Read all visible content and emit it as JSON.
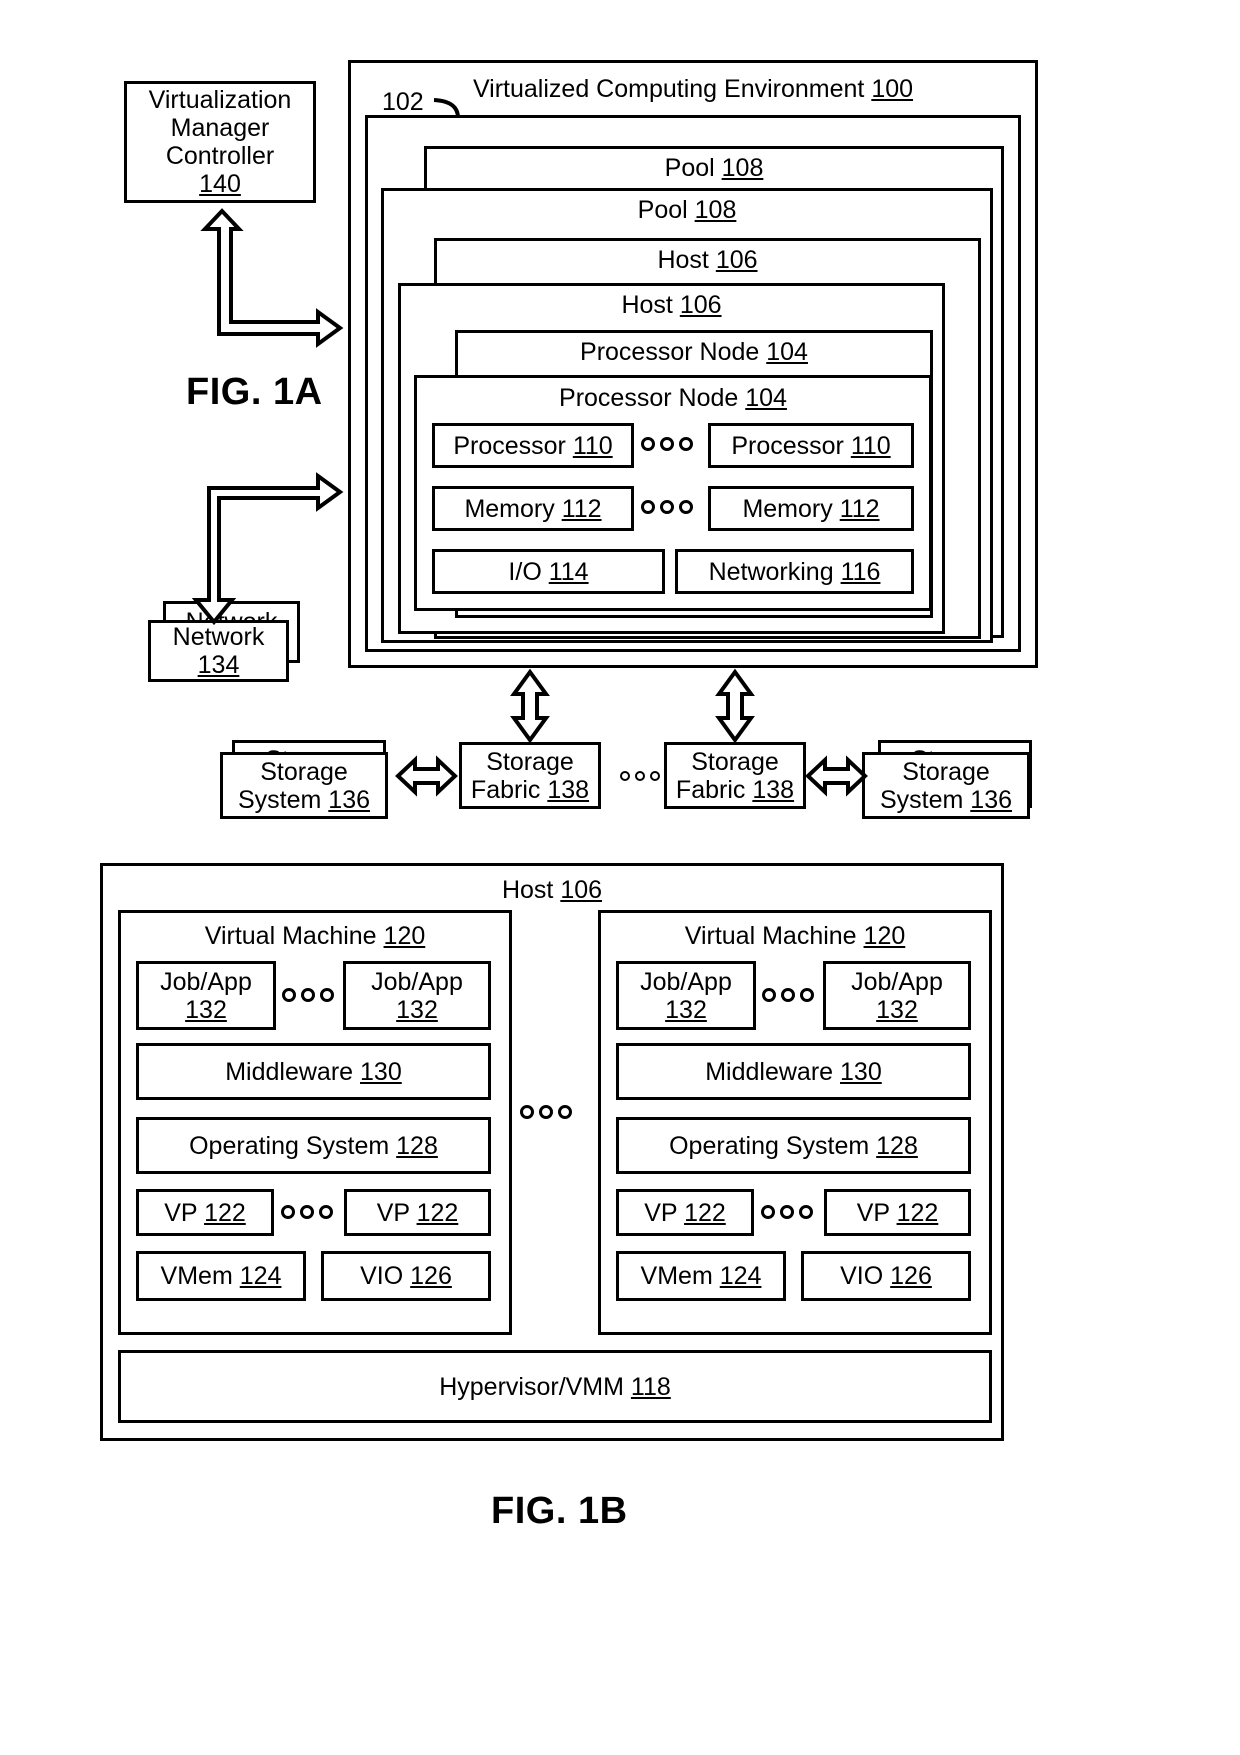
{
  "figures": {
    "fig_a_caption": "FIG. 1A",
    "fig_b_caption": "FIG. 1B"
  },
  "fig_a": {
    "controller": {
      "lines": [
        "Virtualization",
        "Manager",
        "Controller"
      ],
      "ref": "140"
    },
    "environment": {
      "label": "Virtualized Computing Environment",
      "ref": "100"
    },
    "callout_ref": "102",
    "pool_back": {
      "label": "Pool",
      "ref": "108"
    },
    "pool_front": {
      "label": "Pool",
      "ref": "108"
    },
    "host_back": {
      "label": "Host",
      "ref": "106"
    },
    "host_front": {
      "label": "Host",
      "ref": "106"
    },
    "node_back": {
      "label": "Processor Node",
      "ref": "104"
    },
    "node_front": {
      "label": "Processor Node",
      "ref": "104"
    },
    "components": {
      "processor_left": {
        "label": "Processor",
        "ref": "110"
      },
      "processor_right": {
        "label": "Processor",
        "ref": "110"
      },
      "memory_left": {
        "label": "Memory",
        "ref": "112"
      },
      "memory_right": {
        "label": "Memory",
        "ref": "112"
      },
      "io": {
        "label": "I/O",
        "ref": "114"
      },
      "networking": {
        "label": "Networking",
        "ref": "116"
      }
    },
    "network": {
      "label": "Network",
      "ref": "134"
    },
    "storage_system_left": {
      "line1": "Storage",
      "line2": "System",
      "ref": "136"
    },
    "storage_system_right": {
      "line1": "Storage",
      "line2": "System",
      "ref": "136"
    },
    "storage_fabric_left": {
      "line1": "Storage",
      "line2": "Fabric",
      "ref": "138"
    },
    "storage_fabric_right": {
      "line1": "Storage",
      "line2": "Fabric",
      "ref": "138"
    }
  },
  "fig_b": {
    "host": {
      "label": "Host",
      "ref": "106"
    },
    "hypervisor": {
      "label": "Hypervisor/VMM",
      "ref": "118"
    },
    "vms": [
      {
        "title": {
          "label": "Virtual Machine",
          "ref": "120"
        },
        "job_left": {
          "label": "Job/App",
          "ref": "132"
        },
        "job_right": {
          "label": "Job/App",
          "ref": "132"
        },
        "middleware": {
          "label": "Middleware",
          "ref": "130"
        },
        "os": {
          "label": "Operating System",
          "ref": "128"
        },
        "vp_left": {
          "label": "VP",
          "ref": "122"
        },
        "vp_right": {
          "label": "VP",
          "ref": "122"
        },
        "vmem": {
          "label": "VMem",
          "ref": "124"
        },
        "vio": {
          "label": "VIO",
          "ref": "126"
        }
      },
      {
        "title": {
          "label": "Virtual Machine",
          "ref": "120"
        },
        "job_left": {
          "label": "Job/App",
          "ref": "132"
        },
        "job_right": {
          "label": "Job/App",
          "ref": "132"
        },
        "middleware": {
          "label": "Middleware",
          "ref": "130"
        },
        "os": {
          "label": "Operating System",
          "ref": "128"
        },
        "vp_left": {
          "label": "VP",
          "ref": "122"
        },
        "vp_right": {
          "label": "VP",
          "ref": "122"
        },
        "vmem": {
          "label": "VMem",
          "ref": "124"
        },
        "vio": {
          "label": "VIO",
          "ref": "126"
        }
      }
    ]
  },
  "colors": {
    "line": "#000000",
    "background": "#ffffff"
  }
}
